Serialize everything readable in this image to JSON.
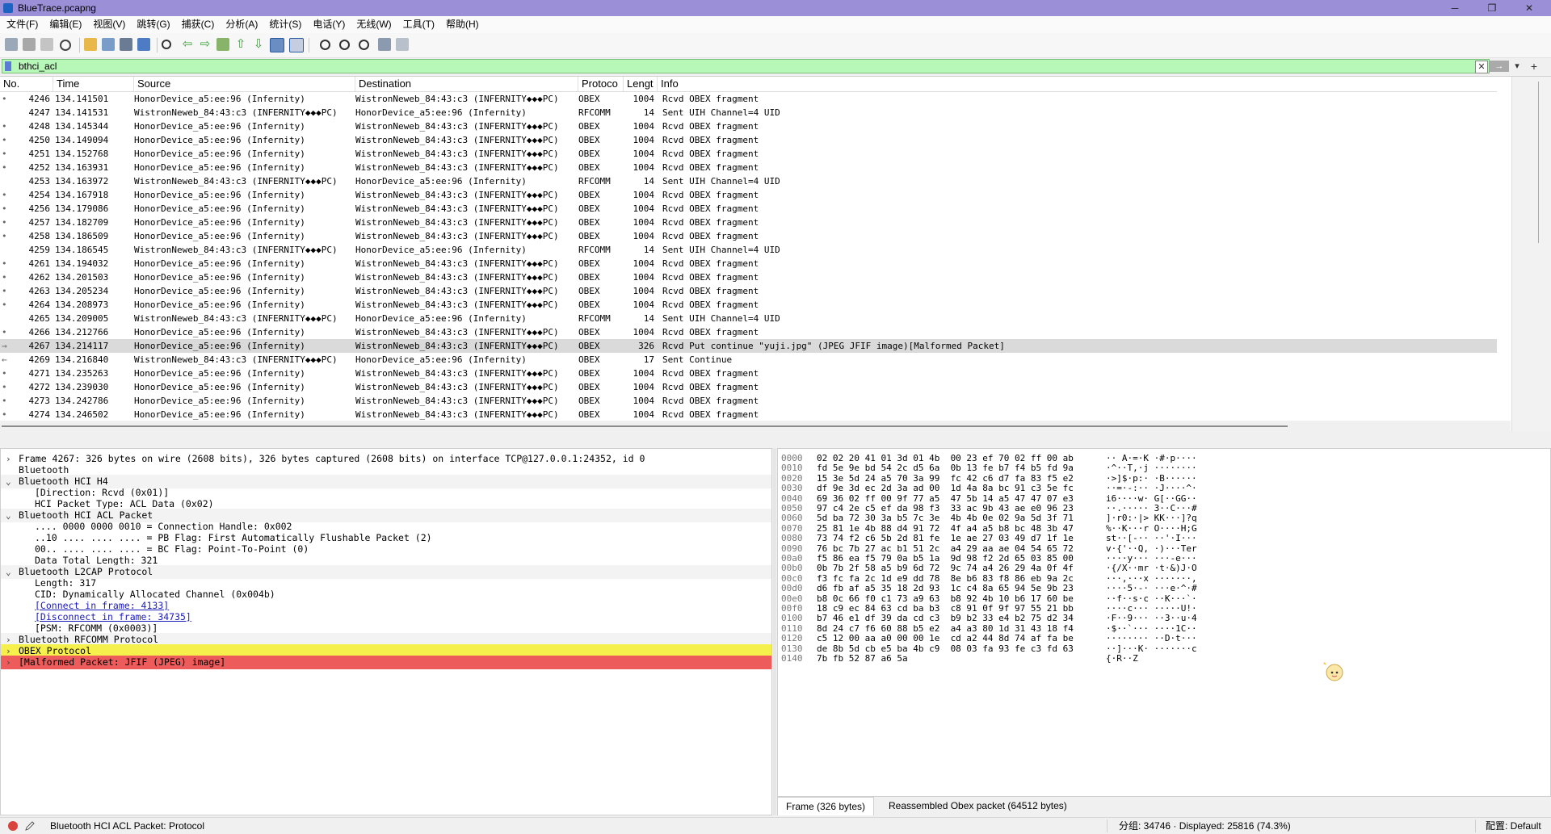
{
  "window": {
    "title": "BlueTrace.pcapng",
    "minimize": "─",
    "maximize": "❐",
    "close": "✕"
  },
  "menu": [
    "文件(F)",
    "编辑(E)",
    "视图(V)",
    "跳转(G)",
    "捕获(C)",
    "分析(A)",
    "统计(S)",
    "电话(Y)",
    "无线(W)",
    "工具(T)",
    "帮助(H)"
  ],
  "filter": {
    "value": "bthci_acl",
    "clear": "✕",
    "apply": "→",
    "dropdown": "▾",
    "add": "+"
  },
  "columns": [
    "No.",
    "Time",
    "Source",
    "Destination",
    "Protoco",
    "Lengt",
    "Info"
  ],
  "packets": [
    {
      "mark": "•",
      "no": "4246",
      "time": "134.141501",
      "src": "HonorDevice_a5:ee:96 (Infernity)",
      "dst": "WistronNeweb_84:43:c3 (INFERNITY◆◆◆PC)",
      "proto": "OBEX",
      "len": "1004",
      "info": "Rcvd OBEX fragment"
    },
    {
      "mark": "",
      "no": "4247",
      "time": "134.141531",
      "src": "WistronNeweb_84:43:c3 (INFERNITY◆◆◆PC)",
      "dst": "HonorDevice_a5:ee:96 (Infernity)",
      "proto": "RFCOMM",
      "len": "14",
      "info": "Sent UIH Channel=4 UID"
    },
    {
      "mark": "•",
      "no": "4248",
      "time": "134.145344",
      "src": "HonorDevice_a5:ee:96 (Infernity)",
      "dst": "WistronNeweb_84:43:c3 (INFERNITY◆◆◆PC)",
      "proto": "OBEX",
      "len": "1004",
      "info": "Rcvd OBEX fragment"
    },
    {
      "mark": "•",
      "no": "4250",
      "time": "134.149094",
      "src": "HonorDevice_a5:ee:96 (Infernity)",
      "dst": "WistronNeweb_84:43:c3 (INFERNITY◆◆◆PC)",
      "proto": "OBEX",
      "len": "1004",
      "info": "Rcvd OBEX fragment"
    },
    {
      "mark": "•",
      "no": "4251",
      "time": "134.152768",
      "src": "HonorDevice_a5:ee:96 (Infernity)",
      "dst": "WistronNeweb_84:43:c3 (INFERNITY◆◆◆PC)",
      "proto": "OBEX",
      "len": "1004",
      "info": "Rcvd OBEX fragment"
    },
    {
      "mark": "•",
      "no": "4252",
      "time": "134.163931",
      "src": "HonorDevice_a5:ee:96 (Infernity)",
      "dst": "WistronNeweb_84:43:c3 (INFERNITY◆◆◆PC)",
      "proto": "OBEX",
      "len": "1004",
      "info": "Rcvd OBEX fragment"
    },
    {
      "mark": "",
      "no": "4253",
      "time": "134.163972",
      "src": "WistronNeweb_84:43:c3 (INFERNITY◆◆◆PC)",
      "dst": "HonorDevice_a5:ee:96 (Infernity)",
      "proto": "RFCOMM",
      "len": "14",
      "info": "Sent UIH Channel=4 UID"
    },
    {
      "mark": "•",
      "no": "4254",
      "time": "134.167918",
      "src": "HonorDevice_a5:ee:96 (Infernity)",
      "dst": "WistronNeweb_84:43:c3 (INFERNITY◆◆◆PC)",
      "proto": "OBEX",
      "len": "1004",
      "info": "Rcvd OBEX fragment"
    },
    {
      "mark": "•",
      "no": "4256",
      "time": "134.179086",
      "src": "HonorDevice_a5:ee:96 (Infernity)",
      "dst": "WistronNeweb_84:43:c3 (INFERNITY◆◆◆PC)",
      "proto": "OBEX",
      "len": "1004",
      "info": "Rcvd OBEX fragment"
    },
    {
      "mark": "•",
      "no": "4257",
      "time": "134.182709",
      "src": "HonorDevice_a5:ee:96 (Infernity)",
      "dst": "WistronNeweb_84:43:c3 (INFERNITY◆◆◆PC)",
      "proto": "OBEX",
      "len": "1004",
      "info": "Rcvd OBEX fragment"
    },
    {
      "mark": "•",
      "no": "4258",
      "time": "134.186509",
      "src": "HonorDevice_a5:ee:96 (Infernity)",
      "dst": "WistronNeweb_84:43:c3 (INFERNITY◆◆◆PC)",
      "proto": "OBEX",
      "len": "1004",
      "info": "Rcvd OBEX fragment"
    },
    {
      "mark": "",
      "no": "4259",
      "time": "134.186545",
      "src": "WistronNeweb_84:43:c3 (INFERNITY◆◆◆PC)",
      "dst": "HonorDevice_a5:ee:96 (Infernity)",
      "proto": "RFCOMM",
      "len": "14",
      "info": "Sent UIH Channel=4 UID"
    },
    {
      "mark": "•",
      "no": "4261",
      "time": "134.194032",
      "src": "HonorDevice_a5:ee:96 (Infernity)",
      "dst": "WistronNeweb_84:43:c3 (INFERNITY◆◆◆PC)",
      "proto": "OBEX",
      "len": "1004",
      "info": "Rcvd OBEX fragment"
    },
    {
      "mark": "•",
      "no": "4262",
      "time": "134.201503",
      "src": "HonorDevice_a5:ee:96 (Infernity)",
      "dst": "WistronNeweb_84:43:c3 (INFERNITY◆◆◆PC)",
      "proto": "OBEX",
      "len": "1004",
      "info": "Rcvd OBEX fragment"
    },
    {
      "mark": "•",
      "no": "4263",
      "time": "134.205234",
      "src": "HonorDevice_a5:ee:96 (Infernity)",
      "dst": "WistronNeweb_84:43:c3 (INFERNITY◆◆◆PC)",
      "proto": "OBEX",
      "len": "1004",
      "info": "Rcvd OBEX fragment"
    },
    {
      "mark": "•",
      "no": "4264",
      "time": "134.208973",
      "src": "HonorDevice_a5:ee:96 (Infernity)",
      "dst": "WistronNeweb_84:43:c3 (INFERNITY◆◆◆PC)",
      "proto": "OBEX",
      "len": "1004",
      "info": "Rcvd OBEX fragment"
    },
    {
      "mark": "",
      "no": "4265",
      "time": "134.209005",
      "src": "WistronNeweb_84:43:c3 (INFERNITY◆◆◆PC)",
      "dst": "HonorDevice_a5:ee:96 (Infernity)",
      "proto": "RFCOMM",
      "len": "14",
      "info": "Sent UIH Channel=4 UID"
    },
    {
      "mark": "•",
      "no": "4266",
      "time": "134.212766",
      "src": "HonorDevice_a5:ee:96 (Infernity)",
      "dst": "WistronNeweb_84:43:c3 (INFERNITY◆◆◆PC)",
      "proto": "OBEX",
      "len": "1004",
      "info": "Rcvd OBEX fragment"
    },
    {
      "mark": "→",
      "no": "4267",
      "time": "134.214117",
      "src": "HonorDevice_a5:ee:96 (Infernity)",
      "dst": "WistronNeweb_84:43:c3 (INFERNITY◆◆◆PC)",
      "proto": "OBEX",
      "len": "326",
      "info": "Rcvd Put continue \"yuji.jpg\" (JPEG JFIF image)[Malformed Packet]",
      "selected": true
    },
    {
      "mark": "←",
      "no": "4269",
      "time": "134.216840",
      "src": "WistronNeweb_84:43:c3 (INFERNITY◆◆◆PC)",
      "dst": "HonorDevice_a5:ee:96 (Infernity)",
      "proto": "OBEX",
      "len": "17",
      "info": "Sent Continue"
    },
    {
      "mark": "•",
      "no": "4271",
      "time": "134.235263",
      "src": "HonorDevice_a5:ee:96 (Infernity)",
      "dst": "WistronNeweb_84:43:c3 (INFERNITY◆◆◆PC)",
      "proto": "OBEX",
      "len": "1004",
      "info": "Rcvd OBEX fragment"
    },
    {
      "mark": "•",
      "no": "4272",
      "time": "134.239030",
      "src": "HonorDevice_a5:ee:96 (Infernity)",
      "dst": "WistronNeweb_84:43:c3 (INFERNITY◆◆◆PC)",
      "proto": "OBEX",
      "len": "1004",
      "info": "Rcvd OBEX fragment"
    },
    {
      "mark": "•",
      "no": "4273",
      "time": "134.242786",
      "src": "HonorDevice_a5:ee:96 (Infernity)",
      "dst": "WistronNeweb_84:43:c3 (INFERNITY◆◆◆PC)",
      "proto": "OBEX",
      "len": "1004",
      "info": "Rcvd OBEX fragment"
    },
    {
      "mark": "•",
      "no": "4274",
      "time": "134.246502",
      "src": "HonorDevice_a5:ee:96 (Infernity)",
      "dst": "WistronNeweb_84:43:c3 (INFERNITY◆◆◆PC)",
      "proto": "OBEX",
      "len": "1004",
      "info": "Rcvd OBEX fragment"
    }
  ],
  "details": [
    {
      "tw": "›",
      "indent": 0,
      "text": "Frame 4267: 326 bytes on wire (2608 bits), 326 bytes captured (2608 bits) on interface TCP@127.0.0.1:24352, id 0"
    },
    {
      "tw": "",
      "indent": 0,
      "text": "Bluetooth"
    },
    {
      "tw": "⌄",
      "indent": 0,
      "text": "Bluetooth HCI H4",
      "hdr": true
    },
    {
      "tw": "",
      "indent": 1,
      "text": "[Direction: Rcvd (0x01)]"
    },
    {
      "tw": "",
      "indent": 1,
      "text": "HCI Packet Type: ACL Data (0x02)"
    },
    {
      "tw": "⌄",
      "indent": 0,
      "text": "Bluetooth HCI ACL Packet",
      "hdr": true
    },
    {
      "tw": "",
      "indent": 1,
      "text": ".... 0000 0000 0010 = Connection Handle: 0x002"
    },
    {
      "tw": "",
      "indent": 1,
      "text": "..10 .... .... .... = PB Flag: First Automatically Flushable Packet (2)"
    },
    {
      "tw": "",
      "indent": 1,
      "text": "00.. .... .... .... = BC Flag: Point-To-Point (0)"
    },
    {
      "tw": "",
      "indent": 1,
      "text": "Data Total Length: 321"
    },
    {
      "tw": "⌄",
      "indent": 0,
      "text": "Bluetooth L2CAP Protocol",
      "hdr": true
    },
    {
      "tw": "",
      "indent": 1,
      "text": "Length: 317"
    },
    {
      "tw": "",
      "indent": 1,
      "text": "CID: Dynamically Allocated Channel (0x004b)"
    },
    {
      "tw": "",
      "indent": 1,
      "text": "[Connect in frame: 4133]",
      "link": true
    },
    {
      "tw": "",
      "indent": 1,
      "text": "[Disconnect in frame: 34735]",
      "link": true
    },
    {
      "tw": "",
      "indent": 1,
      "text": "[PSM: RFCOMM (0x0003)]"
    },
    {
      "tw": "›",
      "indent": 0,
      "text": "Bluetooth RFCOMM Protocol",
      "hdr": true
    },
    {
      "tw": "›",
      "indent": 0,
      "text": "OBEX Protocol",
      "style": "yellow"
    },
    {
      "tw": "›",
      "indent": 0,
      "text": "[Malformed Packet: JFIF (JPEG) image]",
      "style": "red"
    }
  ],
  "bytes": [
    {
      "off": "0000",
      "hex": "02 02 20 41 01 3d 01 4b  00 23 ef 70 02 ff 00 ab",
      "asc": "·· A·=·K ·#·p····"
    },
    {
      "off": "0010",
      "hex": "fd 5e 9e bd 54 2c d5 6a  0b 13 fe b7 f4 b5 fd 9a",
      "asc": "·^··T,·j ········"
    },
    {
      "off": "0020",
      "hex": "15 3e 5d 24 a5 70 3a 99  fc 42 c6 d7 fa 83 f5 e2",
      "asc": "·>]$·p:· ·B······"
    },
    {
      "off": "0030",
      "hex": "df 9e 3d ec 2d 3a ad 00  1d 4a 8a bc 91 c3 5e fc",
      "asc": "··=·-:·· ·J····^·"
    },
    {
      "off": "0040",
      "hex": "69 36 02 ff 00 9f 77 a5  47 5b 14 a5 47 47 07 e3",
      "asc": "i6····w· G[··GG··"
    },
    {
      "off": "0050",
      "hex": "97 c4 2e c5 ef da 98 f3  33 ac 9b 43 ae e0 96 23",
      "asc": "··.····· 3··C···#"
    },
    {
      "off": "0060",
      "hex": "5d ba 72 30 3a b5 7c 3e  4b 4b 0e 02 9a 5d 3f 71",
      "asc": "]·r0:·|> KK···]?q"
    },
    {
      "off": "0070",
      "hex": "25 81 1e 4b 88 d4 91 72  4f a4 a5 b8 bc 48 3b 47",
      "asc": "%··K···r O····H;G"
    },
    {
      "off": "0080",
      "hex": "73 74 f2 c6 5b 2d 81 fe  1e ae 27 03 49 d7 1f 1e",
      "asc": "st··[-·· ··'·I···"
    },
    {
      "off": "0090",
      "hex": "76 bc 7b 27 ac b1 51 2c  a4 29 aa ae 04 54 65 72",
      "asc": "v·{'··Q, ·)···Ter"
    },
    {
      "off": "00a0",
      "hex": "f5 86 ea f5 79 0a b5 1a  9d 98 f2 2d 65 03 85 00",
      "asc": "····y··· ···-e···"
    },
    {
      "off": "00b0",
      "hex": "0b 7b 2f 58 a5 b9 6d 72  9c 74 a4 26 29 4a 0f 4f",
      "asc": "·{/X··mr ·t·&)J·O"
    },
    {
      "off": "00c0",
      "hex": "f3 fc fa 2c 1d e9 dd 78  8e b6 83 f8 86 eb 9a 2c",
      "asc": "···,···x ·······,"
    },
    {
      "off": "00d0",
      "hex": "d6 fb af a5 35 18 2d 93  1c c4 8a 65 94 5e 9b 23",
      "asc": "····5·-· ···e·^·#"
    },
    {
      "off": "00e0",
      "hex": "b8 0c 66 f0 c1 73 a9 63  b8 92 4b 10 b6 17 60 be",
      "asc": "··f··s·c ··K···`·"
    },
    {
      "off": "00f0",
      "hex": "18 c9 ec 84 63 cd ba b3  c8 91 0f 9f 97 55 21 bb",
      "asc": "····c··· ·····U!·"
    },
    {
      "off": "0100",
      "hex": "b7 46 e1 df 39 da cd c3  b9 b2 33 e4 b2 75 d2 34",
      "asc": "·F··9··· ··3··u·4"
    },
    {
      "off": "0110",
      "hex": "8d 24 c7 f6 60 88 b5 e2  a4 a3 80 1d 31 43 18 f4",
      "asc": "·$··`··· ····1C··"
    },
    {
      "off": "0120",
      "hex": "c5 12 00 aa a0 00 00 1e  cd a2 44 8d 74 af fa be",
      "asc": "········ ··D·t···"
    },
    {
      "off": "0130",
      "hex": "de 8b 5d cb e5 ba 4b c9  08 03 fa 93 fe c3 fd 63",
      "asc": "··]···K· ·······c"
    },
    {
      "off": "0140",
      "hex": "7b fb 52 87 a6 5a",
      "asc": "{·R··Z"
    }
  ],
  "bytes_tabs": [
    "Frame (326 bytes)",
    "Reassembled Obex packet (64512 bytes)"
  ],
  "status": {
    "text": "Bluetooth HCI ACL Packet: Protocol",
    "counts": "分组: 34746 · Displayed: 25816 (74.3%)",
    "profile": "配置: Default"
  },
  "colors": {
    "titlebar": "#9b8fd8",
    "filter_ok": "#b7f7b7",
    "selected_row": "#dadada",
    "obex_row": "#f5f04c",
    "malformed_row": "#ee5b5b"
  }
}
